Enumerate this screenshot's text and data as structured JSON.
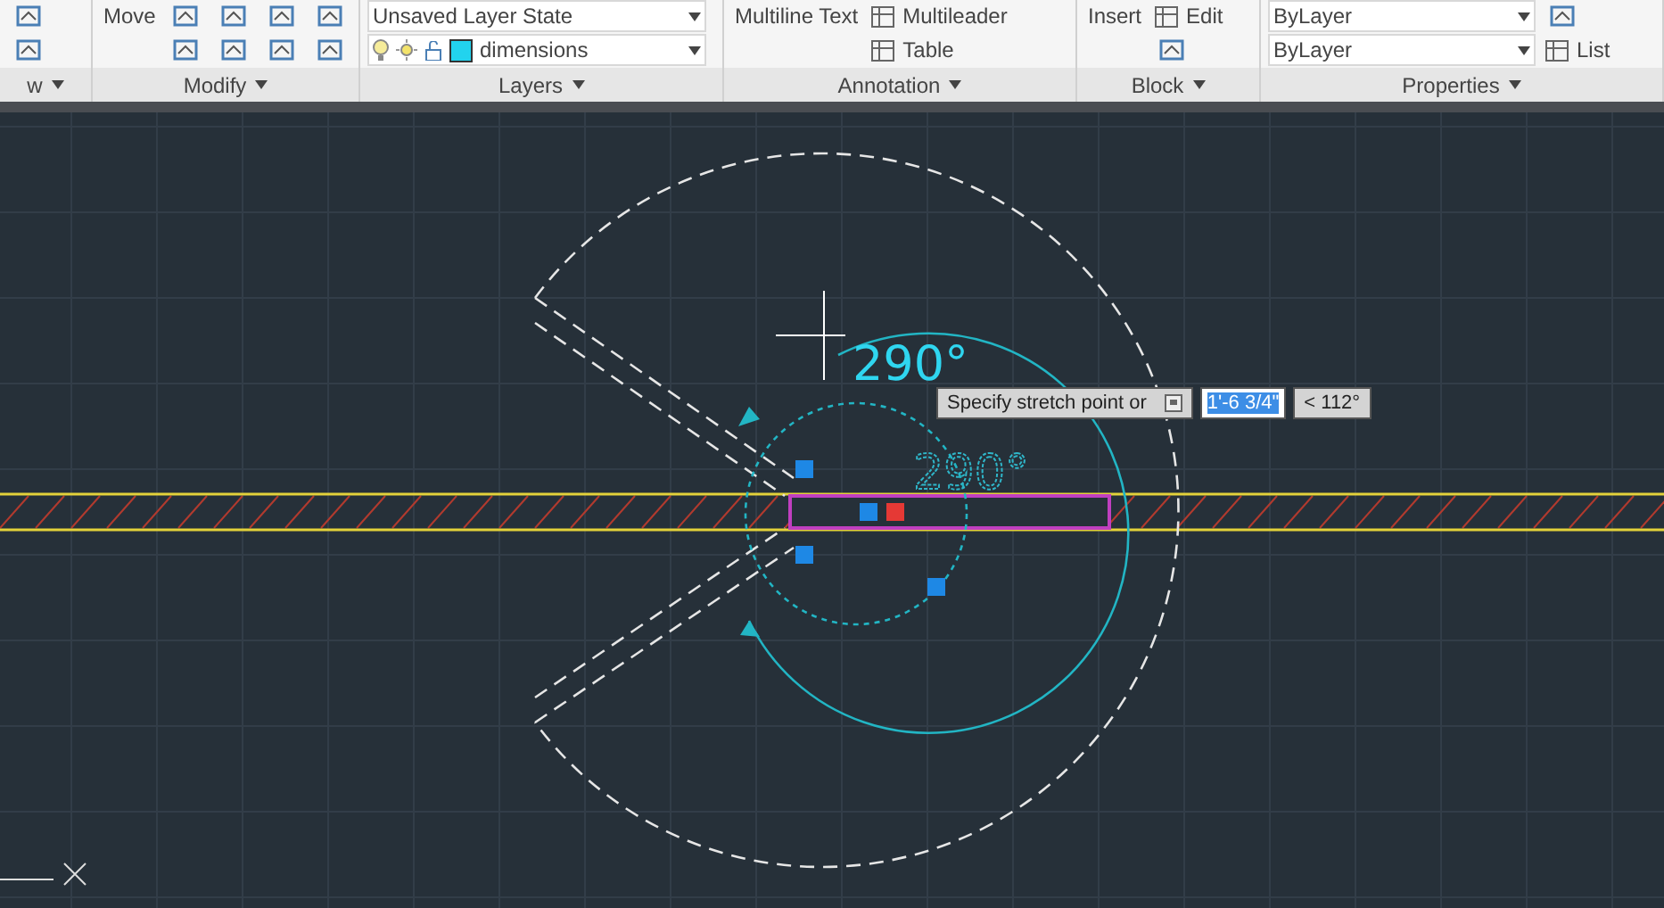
{
  "ribbon": {
    "panels": [
      {
        "title": "w",
        "items": [
          {
            "kind": "tool"
          },
          {
            "kind": "tool"
          }
        ]
      },
      {
        "title": "Modify",
        "items": [
          {
            "kind": "large",
            "label": "Move"
          },
          {
            "kind": "tool"
          },
          {
            "kind": "tool"
          },
          {
            "kind": "tool"
          },
          {
            "kind": "tool"
          },
          {
            "kind": "tool"
          },
          {
            "kind": "tool"
          },
          {
            "kind": "tool"
          },
          {
            "kind": "tool"
          }
        ]
      },
      {
        "title": "Layers",
        "items": [
          {
            "kind": "dropdown",
            "label": "Unsaved Layer State"
          },
          {
            "kind": "layer",
            "label": "dimensions"
          }
        ]
      },
      {
        "title": "Annotation",
        "items": [
          {
            "kind": "large",
            "label": "Multiline Text"
          },
          {
            "kind": "button",
            "label": "Multileader"
          },
          {
            "kind": "button",
            "label": "Table"
          }
        ]
      },
      {
        "title": "Block",
        "items": [
          {
            "kind": "large",
            "label": "Insert"
          },
          {
            "kind": "button",
            "label": "Edit"
          },
          {
            "kind": "tool"
          }
        ]
      },
      {
        "title": "Properties",
        "items": [
          {
            "kind": "dropdown",
            "label": "ByLayer"
          },
          {
            "kind": "dropdown",
            "label": "ByLayer"
          },
          {
            "kind": "tool"
          },
          {
            "kind": "button",
            "label": "List"
          }
        ]
      }
    ]
  },
  "drawing": {
    "dimension_texts": [
      "290°",
      "290°"
    ]
  },
  "tooltip": {
    "prompt": "Specify stretch point or",
    "value": "1'-6 3/4\"",
    "angle": "< 112°"
  }
}
